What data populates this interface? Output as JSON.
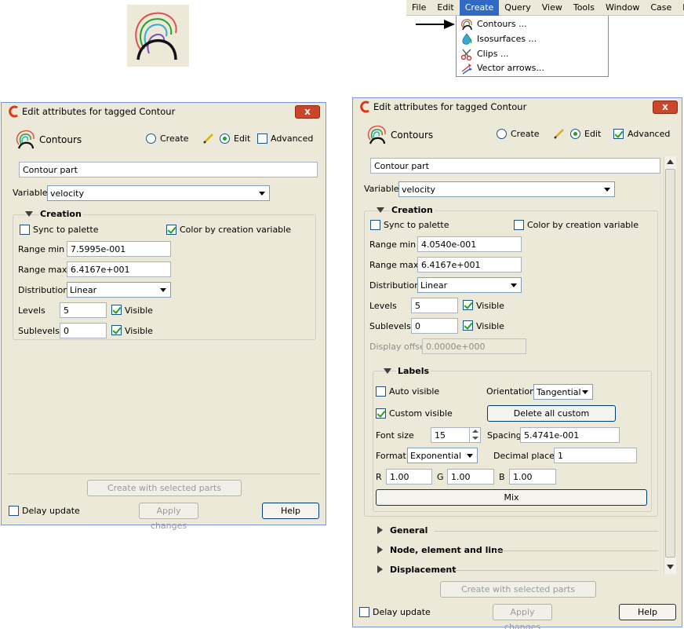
{
  "menubar": {
    "items": [
      "File",
      "Edit",
      "Create",
      "Query",
      "View",
      "Tools",
      "Window",
      "Case",
      "Help"
    ],
    "active": "Create"
  },
  "create_menu": {
    "items": [
      "Contours ...",
      "Isosurfaces ...",
      "Clips ...",
      "Vector arrows..."
    ]
  },
  "left_dialog": {
    "title": "Edit attributes for tagged Contour",
    "close_label": "x",
    "header": {
      "name": "Contours",
      "mode_create": "Create",
      "mode_edit": "Edit",
      "advanced": "Advanced",
      "mode_selected": "Edit",
      "advanced_checked": false
    },
    "part_name": "Contour part",
    "variable_label": "Variable",
    "variable_value": "velocity",
    "creation": {
      "title": "Creation",
      "sync_label": "Sync to palette",
      "sync_checked": false,
      "color_by_label": "Color by creation variable",
      "color_by_checked": true,
      "range_min_label": "Range min",
      "range_min": "7.5995e-001",
      "range_max_label": "Range max",
      "range_max": "6.4167e+001",
      "distribution_label": "Distribution",
      "distribution": "Linear",
      "levels_label": "Levels",
      "levels": "5",
      "levels_visible_label": "Visible",
      "sublevels_label": "Sublevels",
      "sublevels": "0",
      "sublevels_visible_label": "Visible"
    },
    "create_button": "Create with selected parts",
    "delay_update": "Delay update",
    "apply_changes": "Apply changes",
    "help": "Help"
  },
  "right_dialog": {
    "title": "Edit attributes for tagged Contour",
    "close_label": "x",
    "header": {
      "name": "Contours",
      "mode_create": "Create",
      "mode_edit": "Edit",
      "advanced": "Advanced",
      "mode_selected": "Edit",
      "advanced_checked": true
    },
    "part_name": "Contour part",
    "variable_label": "Variable",
    "variable_value": "velocity",
    "creation": {
      "title": "Creation",
      "sync_label": "Sync to palette",
      "color_by_label": "Color by creation variable",
      "range_min_label": "Range min",
      "range_min": "4.0540e-001",
      "range_max_label": "Range max",
      "range_max": "6.4167e+001",
      "distribution_label": "Distribution",
      "distribution": "Linear",
      "levels_label": "Levels",
      "levels": "5",
      "levels_visible_label": "Visible",
      "sublevels_label": "Sublevels",
      "sublevels": "0",
      "sublevels_visible_label": "Visible",
      "display_offset_label": "Display offset",
      "display_offset": "0.0000e+000"
    },
    "labels": {
      "title": "Labels",
      "auto_visible": "Auto visible",
      "orientation_label": "Orientation",
      "orientation": "Tangential",
      "custom_visible": "Custom visible",
      "delete_all_custom": "Delete all custom",
      "font_size_label": "Font size",
      "font_size": "15",
      "spacing_label": "Spacing",
      "spacing": "5.4741e-001",
      "format_label": "Format",
      "format": "Exponential",
      "decimal_places_label": "Decimal places",
      "decimal_places": "1",
      "r_label": "R",
      "r": "1.00",
      "g_label": "G",
      "g": "1.00",
      "b_label": "B",
      "b": "1.00",
      "mix": "Mix"
    },
    "sections": [
      "General",
      "Node, element and line",
      "Displacement"
    ],
    "create_button": "Create with selected parts",
    "delay_update": "Delay update",
    "apply_changes": "Apply changes",
    "help": "Help"
  },
  "colors": {
    "window_bg": "#ece9d8",
    "menu_highlight": "#316ac5",
    "check_green": "#21a121",
    "close_red": "#c9462b"
  }
}
